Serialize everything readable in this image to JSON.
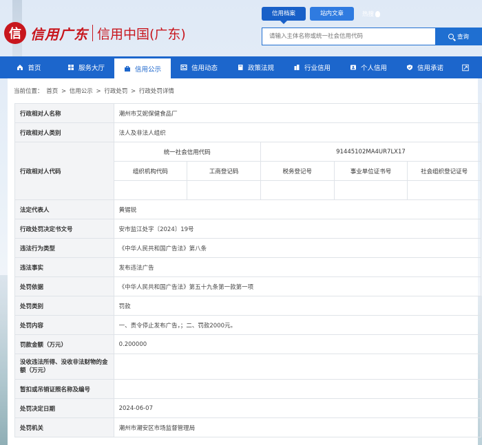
{
  "header": {
    "logo_char": "信",
    "logo_script": "信用广东",
    "logo_text": "信用中国(广东)",
    "search_tabs": [
      "信用档案",
      "站内文章"
    ],
    "hot_label": "热搜",
    "search_placeholder": "请输入主体名称或统一社会信用代码",
    "search_button": "查询"
  },
  "nav": {
    "items": [
      {
        "label": "首页",
        "icon": "home-icon"
      },
      {
        "label": "服务大厅",
        "icon": "grid-icon"
      },
      {
        "label": "信用公示",
        "icon": "briefcase-icon",
        "active": true
      },
      {
        "label": "信用动态",
        "icon": "news-icon"
      },
      {
        "label": "政策法规",
        "icon": "book-icon"
      },
      {
        "label": "行业信用",
        "icon": "building-icon"
      },
      {
        "label": "个人信用",
        "icon": "id-card-icon"
      },
      {
        "label": "信用承诺",
        "icon": "shield-icon"
      }
    ],
    "expand_icon": "expand-icon"
  },
  "breadcrumb": {
    "prefix": "当前位置：",
    "items": [
      "首页",
      "信用公示",
      "行政处罚",
      "行政处罚详情"
    ],
    "separator": ">"
  },
  "detail": {
    "name_label": "行政相对人名称",
    "name_value": "潮州市艾妮保健食品厂",
    "category_label": "行政相对人类别",
    "category_value": "法人及非法人组织",
    "code_label": "行政相对人代码",
    "uscc_label": "统一社会信用代码",
    "uscc_value": "91445102MA4UR7LX17",
    "sub_codes": [
      "组织机构代码",
      "工商登记码",
      "税务登记号",
      "事业单位证书号",
      "社会组织登记证号"
    ],
    "sub_values": [
      "",
      "",
      "",
      "",
      ""
    ],
    "rows": [
      {
        "label": "法定代表人",
        "value": "黄锡锐"
      },
      {
        "label": "行政处罚决定书文号",
        "value": "安市监江处字〔2024〕19号"
      },
      {
        "label": "违法行为类型",
        "value": "《中华人民共和国广告法》第八条"
      },
      {
        "label": "违法事实",
        "value": "发布违法广告"
      },
      {
        "label": "处罚依据",
        "value": "《中华人民共和国广告法》第五十九条第一款第一项"
      },
      {
        "label": "处罚类别",
        "value": "罚款"
      },
      {
        "label": "处罚内容",
        "value": "一、责令停止发布广告，；二、罚款2000元。"
      },
      {
        "label": "罚款金额（万元）",
        "value": "0.200000"
      },
      {
        "label": "没收违法所得、没收非法财物的金额（万元）",
        "value": ""
      },
      {
        "label": "暂扣或吊销证照名称及编号",
        "value": ""
      },
      {
        "label": "处罚决定日期",
        "value": "2024-06-07"
      },
      {
        "label": "处罚机关",
        "value": "潮州市潮安区市场监督管理局"
      }
    ]
  },
  "colors": {
    "brand_red": "#c8161d",
    "nav_blue": "#1c66cc"
  }
}
